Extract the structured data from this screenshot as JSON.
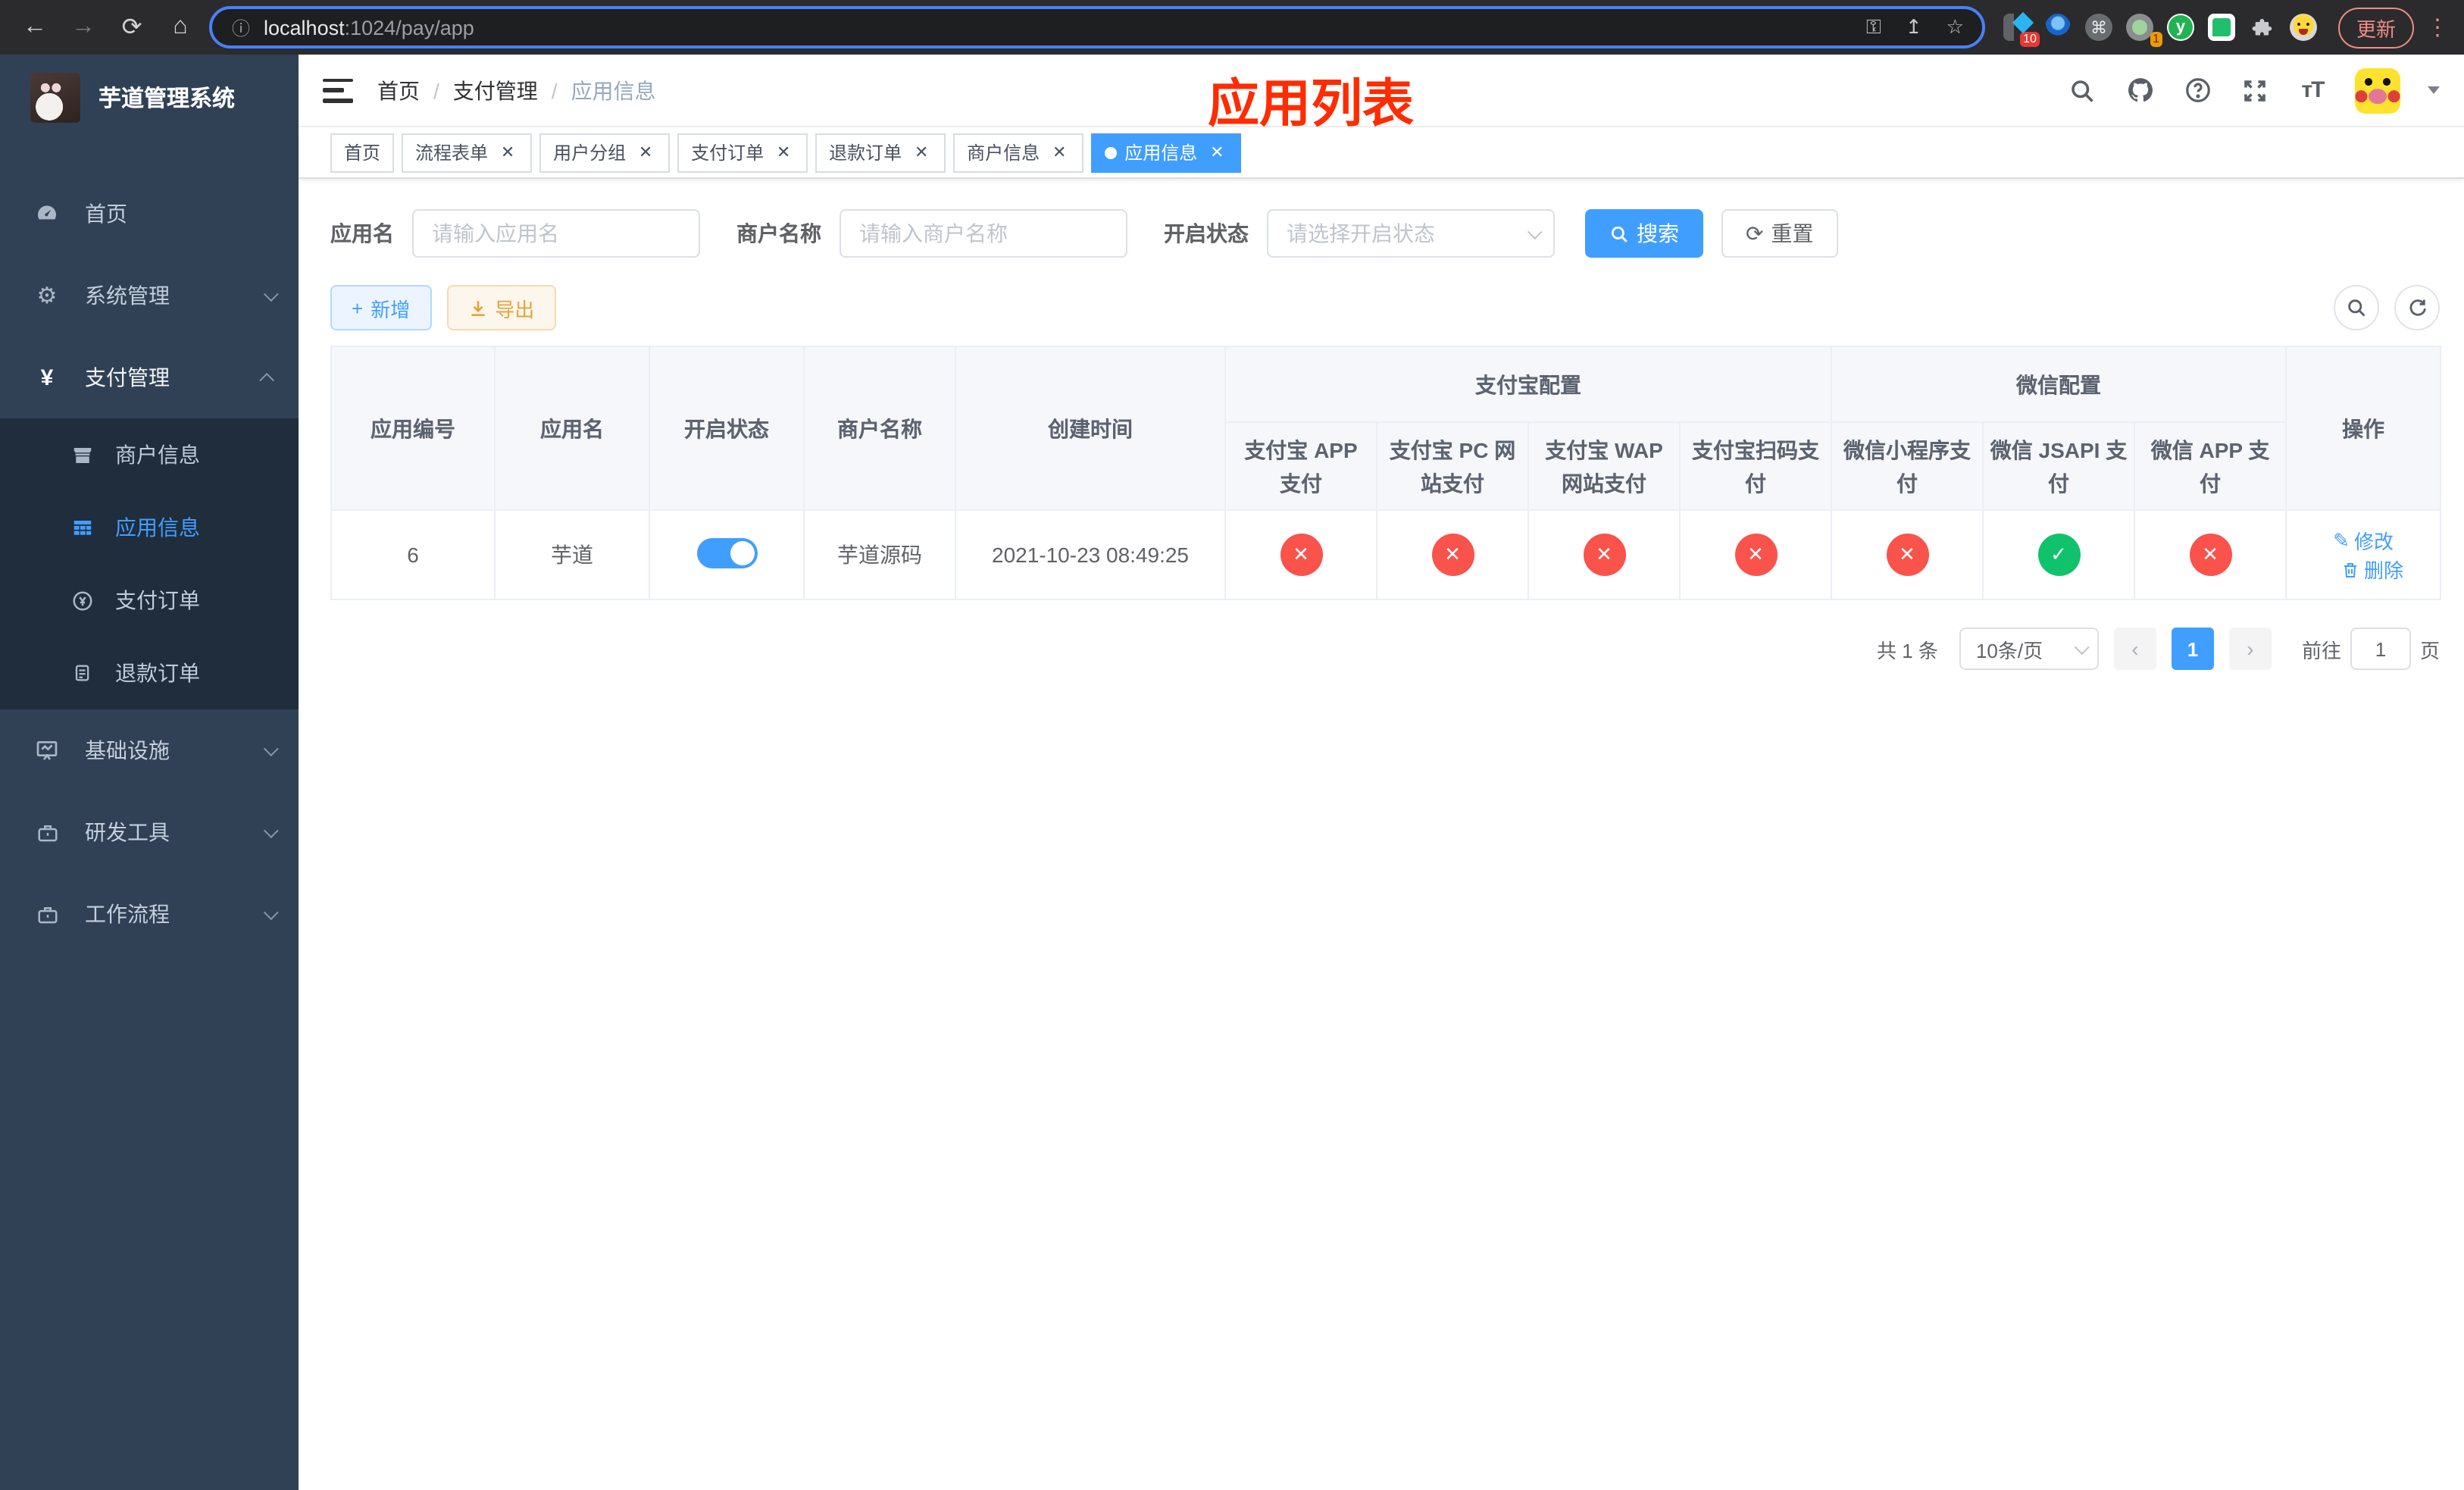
{
  "browser": {
    "url_host": "localhost",
    "url_rest": ":1024/pay/app",
    "update_label": "更新",
    "ext_badge_blue_diamond": "10",
    "ext_badge_recorder": "1"
  },
  "icons": {
    "back": "←",
    "forward": "→",
    "reload": "⟳",
    "home": "⌂",
    "info": "ⓘ",
    "key": "⚿",
    "share": "↥",
    "star": "☆",
    "command": "⌘",
    "puzzle": "",
    "kebab": "⋮",
    "question": "?",
    "font_size": "тT",
    "caret": "",
    "yen": "¥",
    "gear": "⚙",
    "plus": "+",
    "refresh": "⟳",
    "edit": "✎",
    "check": "✓",
    "cross": "✕",
    "prev": "‹",
    "next": "›"
  },
  "sidebar": {
    "title": "芋道管理系统",
    "items": [
      {
        "label": "首页"
      },
      {
        "label": "系统管理"
      },
      {
        "label": "支付管理"
      },
      {
        "label": "基础设施"
      },
      {
        "label": "研发工具"
      },
      {
        "label": "工作流程"
      }
    ],
    "sub_items": [
      {
        "label": "商户信息"
      },
      {
        "label": "应用信息"
      },
      {
        "label": "支付订单"
      },
      {
        "label": "退款订单"
      }
    ]
  },
  "breadcrumb": {
    "items": [
      "首页",
      "支付管理",
      "应用信息"
    ],
    "separator": "/"
  },
  "annotation": "应用列表",
  "tabs": [
    {
      "label": "首页"
    },
    {
      "label": "流程表单"
    },
    {
      "label": "用户分组"
    },
    {
      "label": "支付订单"
    },
    {
      "label": "退款订单"
    },
    {
      "label": "商户信息"
    },
    {
      "label": "应用信息"
    }
  ],
  "filters": {
    "app_name_label": "应用名",
    "app_name_placeholder": "请输入应用名",
    "merchant_label": "商户名称",
    "merchant_placeholder": "请输入商户名称",
    "status_label": "开启状态",
    "status_placeholder": "请选择开启状态",
    "search_label": "搜索",
    "reset_label": "重置"
  },
  "toolbar": {
    "add_label": "新增",
    "export_label": "导出"
  },
  "table": {
    "groups": {
      "alipay": "支付宝配置",
      "wechat": "微信配置"
    },
    "cols": [
      "应用编号",
      "应用名",
      "开启状态",
      "商户名称",
      "创建时间",
      "支付宝 APP 支付",
      "支付宝 PC 网站支付",
      "支付宝 WAP 网站支付",
      "支付宝扫码支付",
      "微信小程序支付",
      "微信 JSAPI 支付",
      "微信 APP 支付",
      "操作"
    ],
    "row": {
      "id": "6",
      "name": "芋道",
      "enabled": true,
      "merchant": "芋道源码",
      "created": "2021-10-23 08:49:25",
      "configs": {
        "alipay_app": "disabled",
        "alipay_pc": "disabled",
        "alipay_wap": "disabled",
        "alipay_qr": "disabled",
        "wechat_lite": "disabled",
        "wechat_jsapi": "enabled",
        "wechat_app": "disabled"
      },
      "edit_label": "修改",
      "delete_label": "删除"
    }
  },
  "pagination": {
    "total": "共 1 条",
    "size": "10条/页",
    "page": "1",
    "goto_label": "前往",
    "goto_value": "1",
    "page_unit": "页"
  },
  "colors": {
    "primary": "#409eff",
    "danger": "#f9534b",
    "success": "#11c26d",
    "warning": "#e6a23c",
    "annotation_red": "#fe2c00",
    "sidebar_bg": "#304156",
    "submenu_bg": "#1f2d3d"
  }
}
